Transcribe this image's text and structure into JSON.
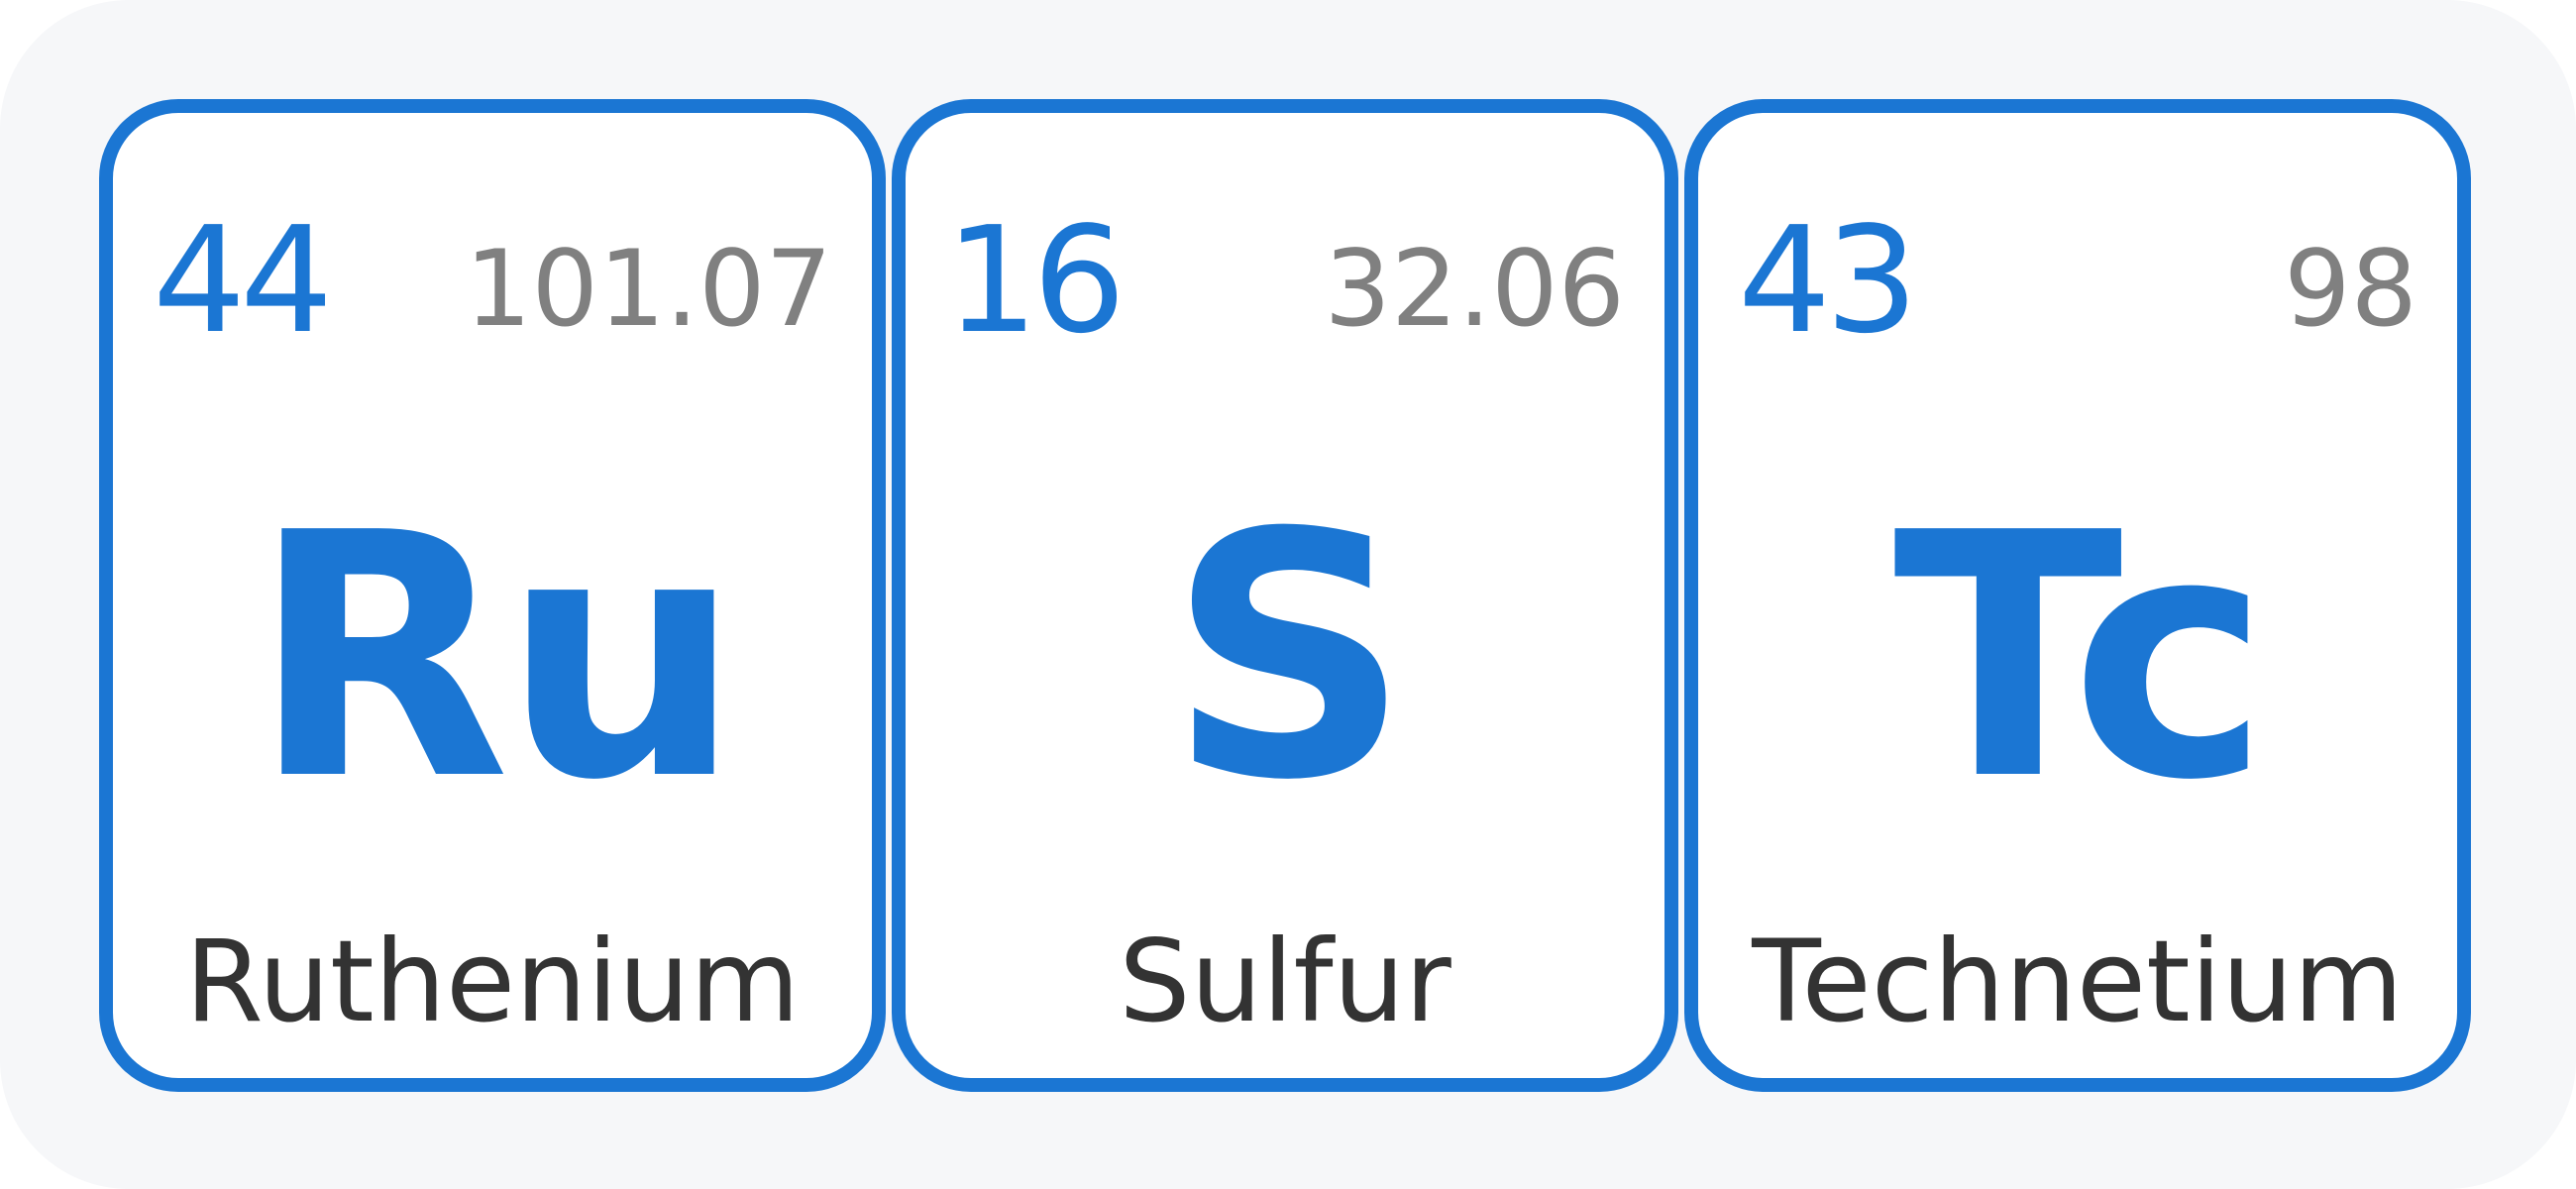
{
  "elements": [
    {
      "atomic_number": "44",
      "atomic_mass": "101.07",
      "symbol": "Ru",
      "name": "Ruthenium"
    },
    {
      "atomic_number": "16",
      "atomic_mass": "32.06",
      "symbol": "S",
      "name": "Sulfur"
    },
    {
      "atomic_number": "43",
      "atomic_mass": "98",
      "symbol": "Tc",
      "name": "Technetium"
    }
  ],
  "colors": {
    "accent": "#1b76d3",
    "mass_text": "#808080",
    "name_text": "#333333",
    "background": "#f6f7f9",
    "tile_background": "#ffffff"
  }
}
